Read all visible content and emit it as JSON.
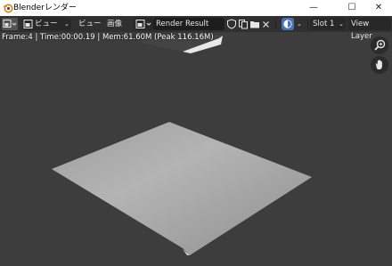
{
  "window": {
    "title": "Blenderレンダー",
    "minimize": "—",
    "maximize": "☐",
    "close": "✕"
  },
  "header": {
    "view_menu_dropdown": "ビュー",
    "view_menu": "ビュー",
    "image_menu": "画像",
    "image_name": "Render Result",
    "slot": "Slot 1",
    "view_layer": "View Layer"
  },
  "render_info": "Frame:4 | Time:00:00.19 | Mem:61.60M (Peak 116.16M)",
  "colors": {
    "background": "#3d3d3d",
    "header": "#303030",
    "plane_light": "#b4b4b4",
    "plane_dark": "#8c8c8c",
    "accent_blue": "#4772b3"
  },
  "icons": [
    "blender-logo-icon",
    "editor-type-icon",
    "image-type-icon",
    "shield-icon",
    "duplicate-icon",
    "folder-icon",
    "close-icon",
    "display-channels-icon",
    "zoom-icon",
    "hand-icon"
  ]
}
